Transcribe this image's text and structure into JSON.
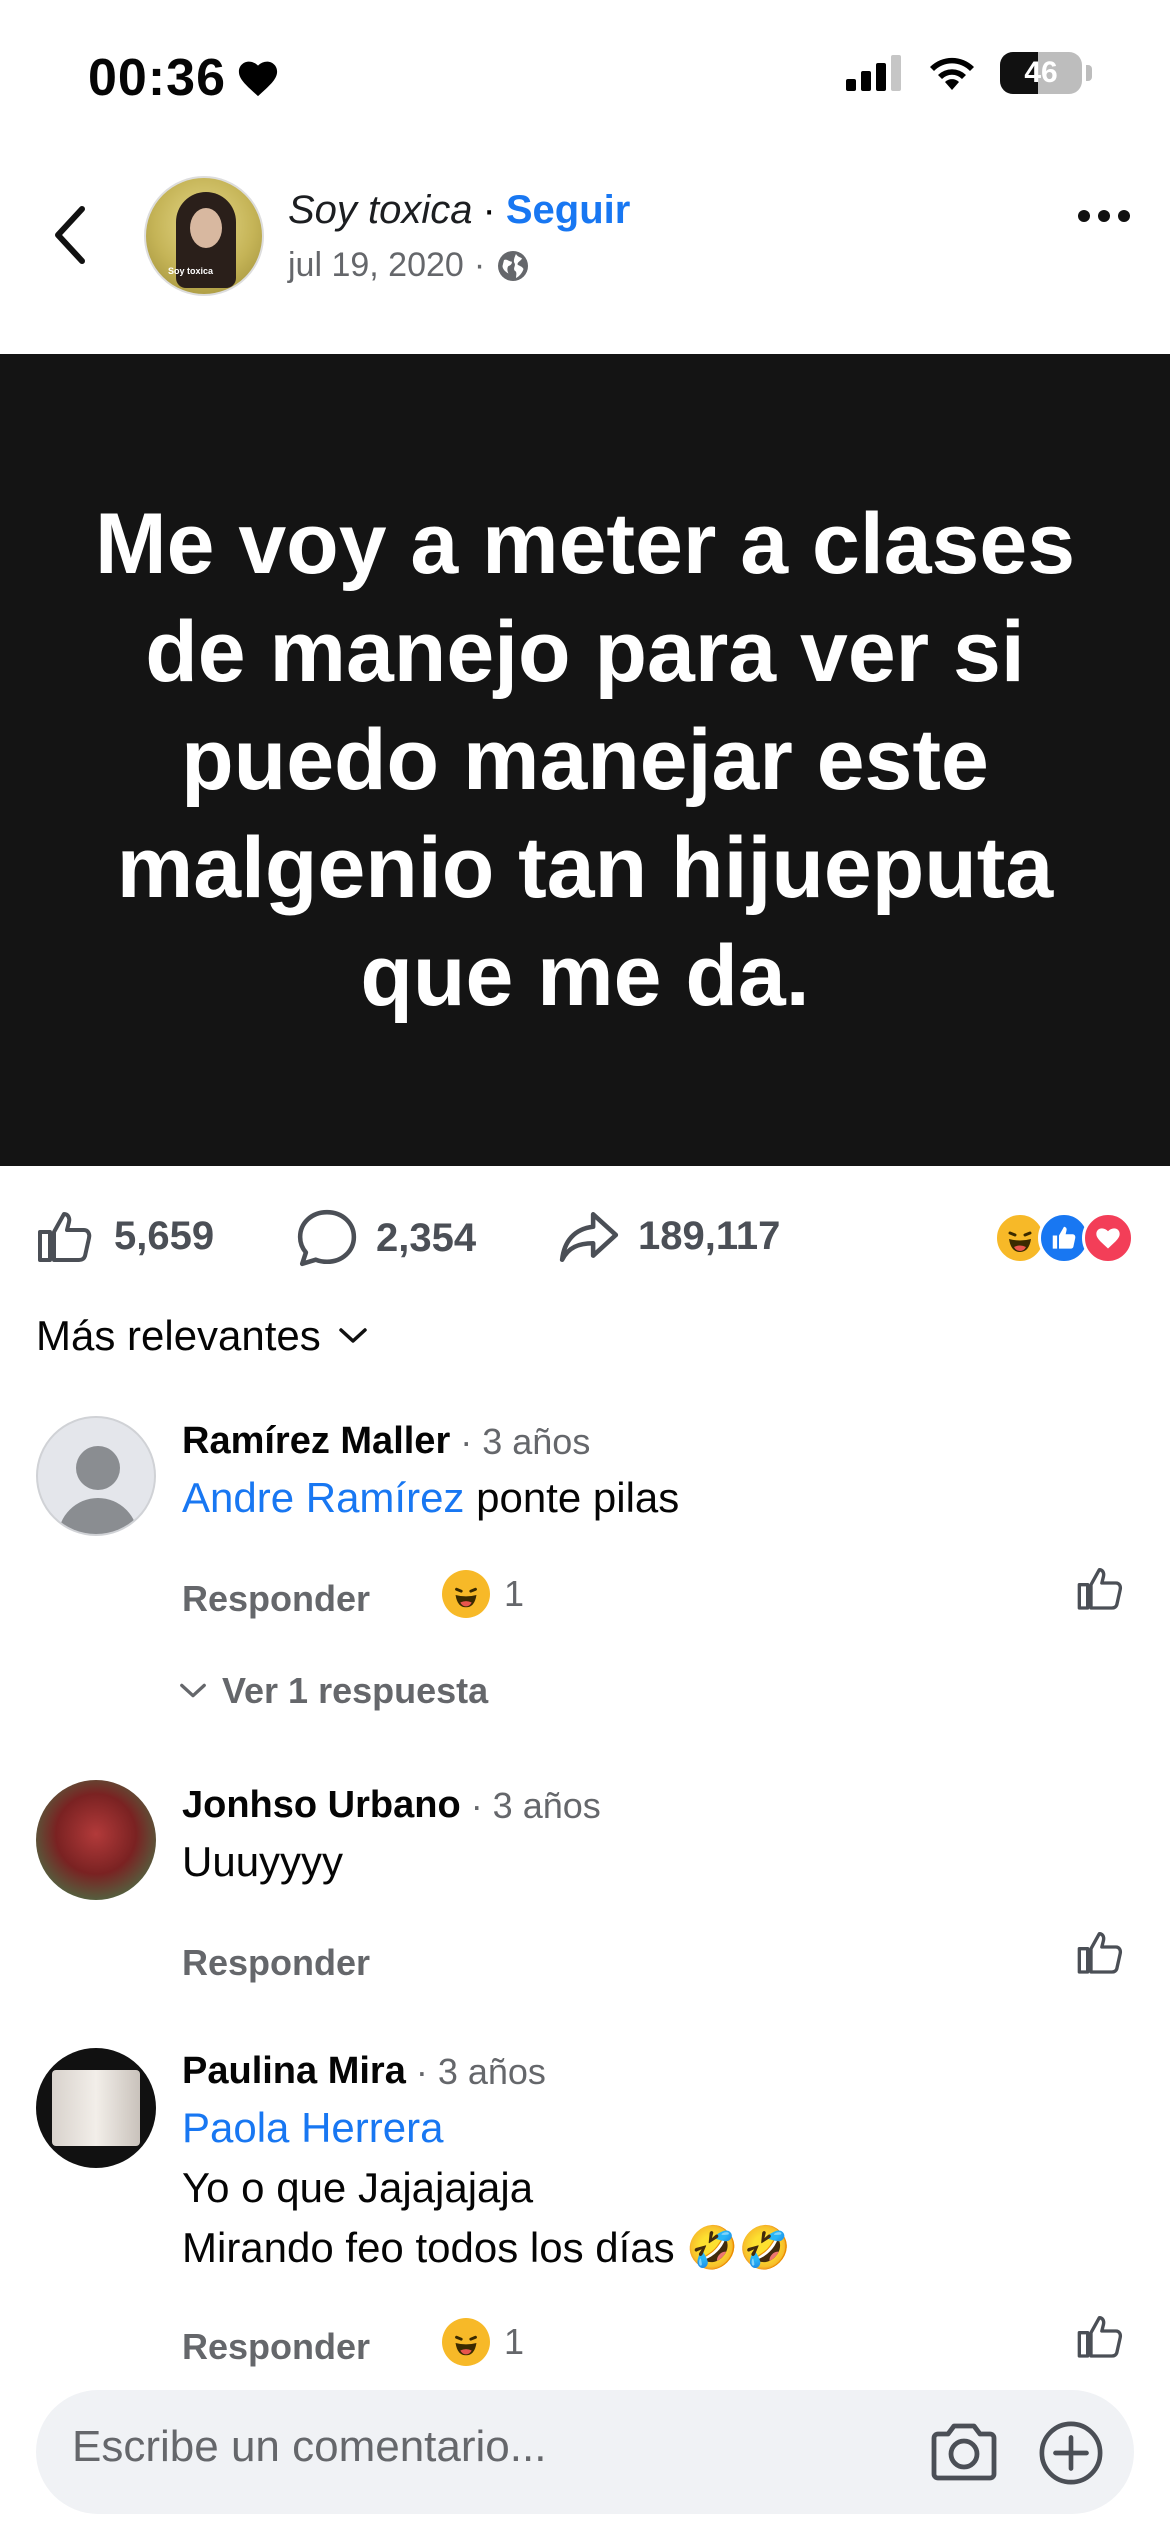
{
  "status": {
    "time": "00:36",
    "battery": "46",
    "battery_fraction": 0.46
  },
  "header": {
    "page_name": "Soy toxica",
    "separator": "·",
    "follow_label": "Seguir",
    "date": "jul 19, 2020",
    "meta_separator": "·",
    "avatar_tag": "Soy toxica"
  },
  "post": {
    "text": "Me voy a meter a clases de manejo para ver si puedo manejar este malgenio tan hijueputa que me da."
  },
  "stats": {
    "likes": "5,659",
    "comments": "2,354",
    "shares": "189,117",
    "reactions": [
      "haha-icon",
      "like-icon",
      "love-icon"
    ]
  },
  "sort": {
    "label": "Más relevantes"
  },
  "comments": [
    {
      "author": "Ramírez Maller",
      "time": "· 3 años",
      "mention": "Andre Ramírez",
      "text": " ponte pilas",
      "reply_label": "Responder",
      "reaction_count": "1",
      "view_replies": "Ver 1 respuesta"
    },
    {
      "author": "Jonhso Urbano",
      "time": "· 3 años",
      "text": "Uuuyyyy",
      "reply_label": "Responder"
    },
    {
      "author": "Paulina Mira",
      "time": "· 3 años",
      "mention": "Paola Herrera",
      "line1": "Yo o que Jajajajaja",
      "line2": "Mirando feo todos los días 🤣🤣",
      "reply_label": "Responder",
      "reaction_count": "1"
    }
  ],
  "composer": {
    "placeholder": "Escribe un comentario..."
  }
}
